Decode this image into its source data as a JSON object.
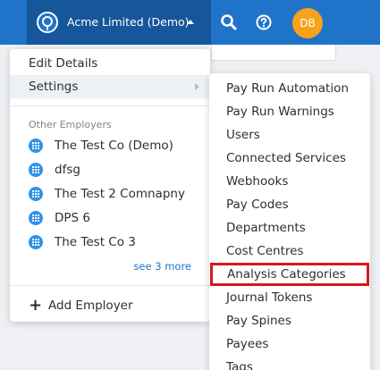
{
  "topbar": {
    "employer_name": "Acme Limited (Demo)",
    "avatar_initials": "DB",
    "colors": {
      "bar": "#1f74c9",
      "switcher": "#16569b",
      "avatar": "#f7a21b"
    }
  },
  "menu": {
    "items": [
      {
        "label": "Edit Details"
      },
      {
        "label": "Settings"
      }
    ],
    "other_employers_label": "Other Employers",
    "employers": [
      {
        "label": "The Test Co (Demo)"
      },
      {
        "label": "dfsg"
      },
      {
        "label": "The Test 2 Comnapny"
      },
      {
        "label": "DPS 6"
      },
      {
        "label": "The Test Co 3"
      }
    ],
    "see_more": "see 3 more",
    "add_employer": "Add Employer"
  },
  "settings_submenu": {
    "items": [
      {
        "label": "Pay Run Automation"
      },
      {
        "label": "Pay Run Warnings"
      },
      {
        "label": "Users"
      },
      {
        "label": "Connected Services"
      },
      {
        "label": "Webhooks"
      },
      {
        "label": "Pay Codes"
      },
      {
        "label": "Departments"
      },
      {
        "label": "Cost Centres"
      },
      {
        "label": "Analysis Categories"
      },
      {
        "label": "Journal Tokens"
      },
      {
        "label": "Pay Spines"
      },
      {
        "label": "Payees"
      },
      {
        "label": "Tags"
      }
    ],
    "highlight_color": "#d9161c"
  }
}
